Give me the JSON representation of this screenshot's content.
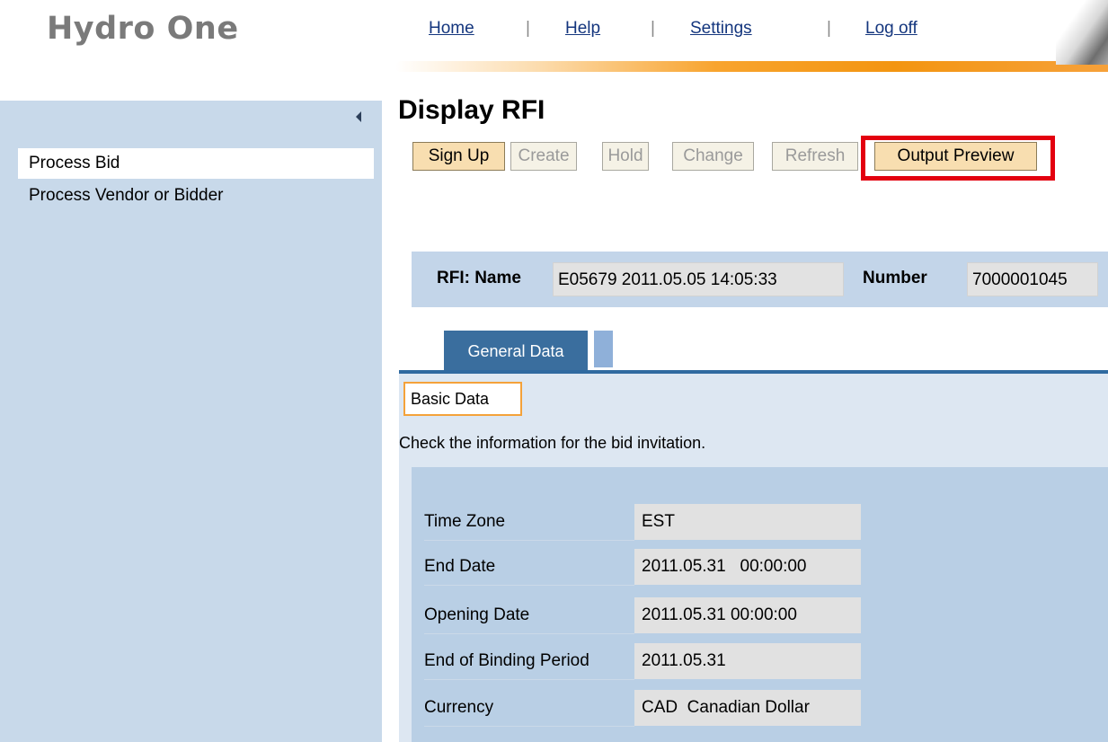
{
  "header": {
    "brand": "Hydro One",
    "nav": [
      {
        "label": "Home"
      },
      {
        "label": "Help"
      },
      {
        "label": "Settings"
      },
      {
        "label": "Log off"
      }
    ],
    "separator": "|"
  },
  "sidebar": {
    "items": [
      {
        "label": "Process Bid",
        "selected": true
      },
      {
        "label": "Process Vendor or Bidder",
        "selected": false
      }
    ]
  },
  "main": {
    "title": "Display RFI",
    "toolbar": [
      {
        "label": "Sign Up",
        "enabled": true
      },
      {
        "label": "Create",
        "enabled": false
      },
      {
        "label": "Hold",
        "enabled": false
      },
      {
        "label": "Change",
        "enabled": false
      },
      {
        "label": "Refresh",
        "enabled": false
      },
      {
        "label": "Output Preview",
        "enabled": true,
        "highlighted": true
      }
    ],
    "rfi": {
      "name_label": "RFI: Name",
      "name_value": "E05679 2011.05.05 14:05:33",
      "number_label": "Number",
      "number_value": "7000001045"
    },
    "tabs": [
      {
        "label": "General Data",
        "active": true
      }
    ],
    "subtab": "Basic Data",
    "info_text": "Check the information for the bid invitation.",
    "fields": [
      {
        "label": "Time Zone",
        "value": "EST"
      },
      {
        "label": "End Date",
        "value": "2011.05.31   00:00:00"
      },
      {
        "label": "Opening Date",
        "value": "2011.05.31 00:00:00"
      },
      {
        "label": "End of Binding Period",
        "value": "2011.05.31"
      },
      {
        "label": "Currency",
        "value": "CAD  Canadian Dollar"
      }
    ]
  },
  "colors": {
    "accent_orange": "#f39511",
    "highlight_red": "#e3000f",
    "tab_blue": "#3a6e9e",
    "sidebar_bg": "#c8d9ea"
  }
}
